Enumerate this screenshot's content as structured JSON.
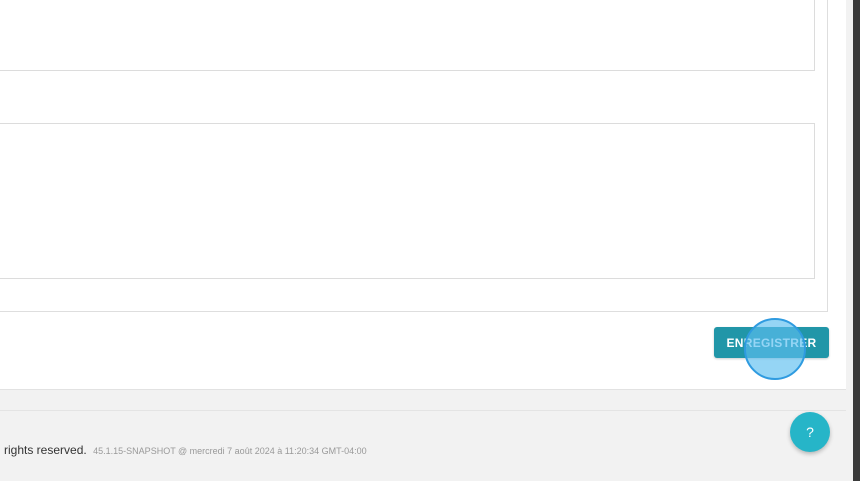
{
  "form": {
    "save_label": "ENREGISTRER"
  },
  "footer": {
    "copyright": "rights reserved.",
    "version": "45.1.15-SNAPSHOT @ mercredi 7 août 2024 à 11:20:34 GMT-04:00"
  },
  "help": {
    "label": "?"
  },
  "colors": {
    "primary": "#2196a8",
    "help_button": "#26b5c8",
    "click_indicator": "#5cbef0"
  }
}
